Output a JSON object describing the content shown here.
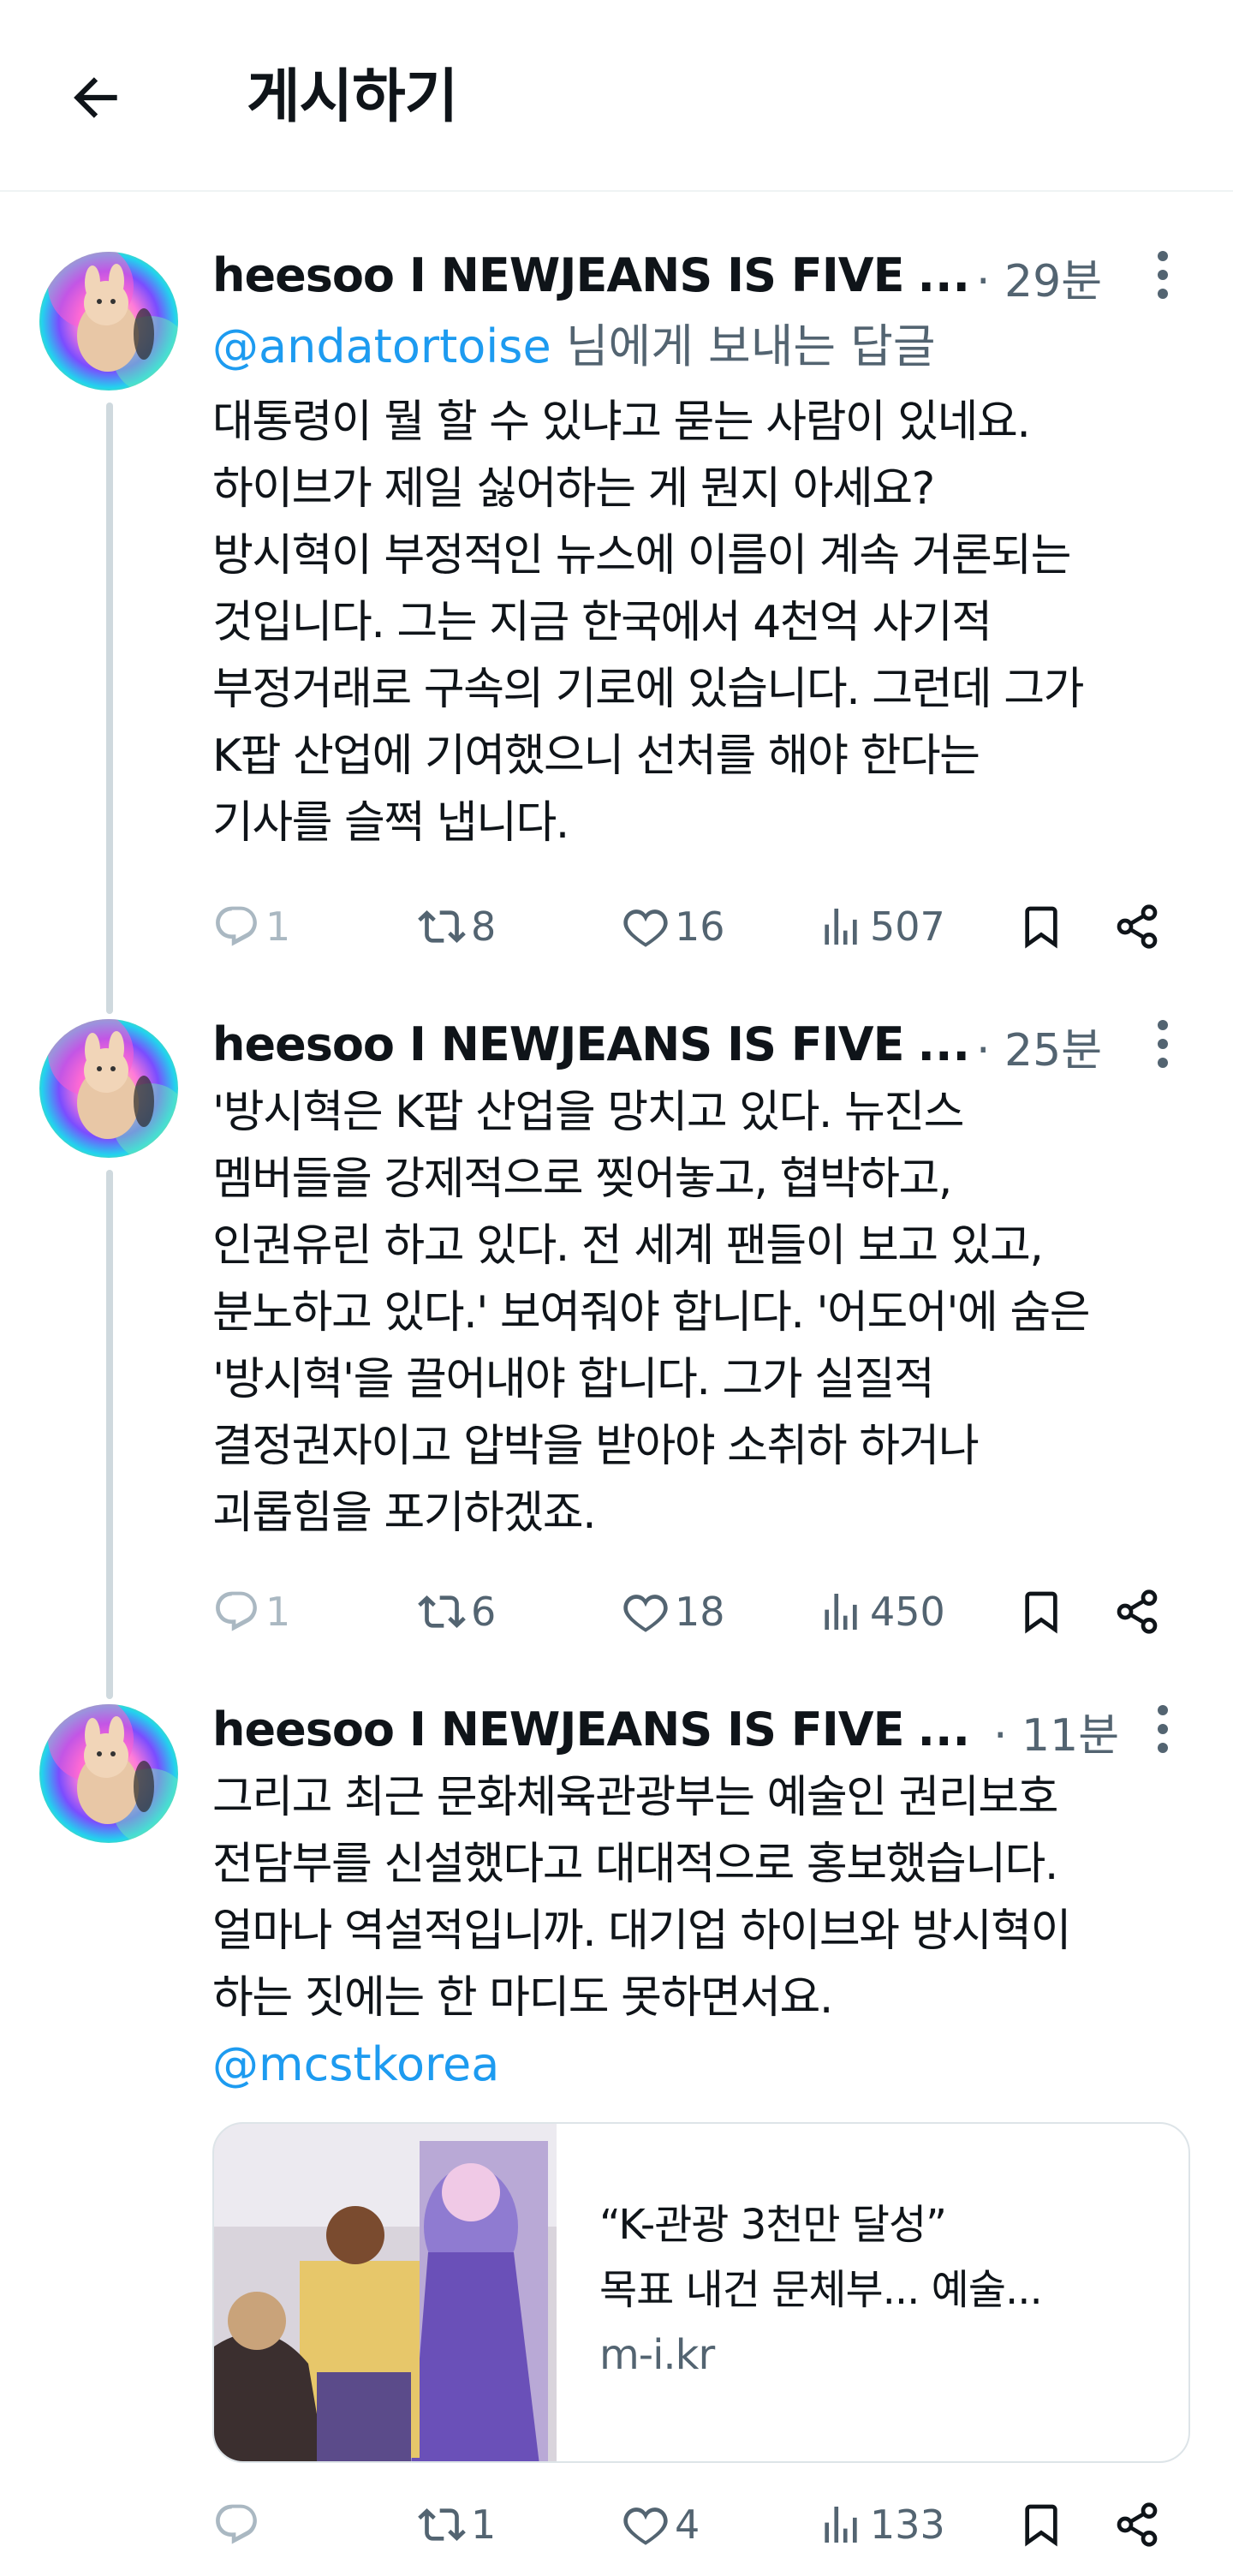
{
  "header": {
    "title": "게시하기",
    "back_icon": "arrow-left-icon"
  },
  "colors": {
    "accent": "#1d9bf0",
    "muted": "#536471",
    "text": "#0f1419",
    "border": "#eff3f4"
  },
  "posts": [
    {
      "display_name": "heesoo I NEWJEANS IS FIVE",
      "ellipsis": "...",
      "time": "· 29분",
      "reply_to": {
        "handle": "@andatortoise",
        "suffix": " 님에게 보내는 답글"
      },
      "lines": [
        "대통령이 뭘 할 수 있냐고 묻는 사람이 있네요.",
        "하이브가 제일 싫어하는 게 뭔지 아세요?",
        "방시혁이 부정적인 뉴스에 이름이 계속 거론되는",
        "것입니다. 그는 지금 한국에서 4천억 사기적",
        "부정거래로 구속의 기로에 있습니다. 그런데 그가",
        "K팝 산업에 기여했으니 선처를 해야 한다는",
        "기사를 슬쩍 냅니다."
      ],
      "stats": {
        "replies": "1",
        "reposts": "8",
        "likes": "16",
        "views": "507"
      }
    },
    {
      "display_name": "heesoo I NEWJEANS IS FIVE",
      "ellipsis": "...",
      "time": "· 25분",
      "lines": [
        "'방시혁은 K팝 산업을 망치고 있다. 뉴진스",
        "멤버들을 강제적으로 찢어놓고, 협박하고,",
        "인권유린 하고 있다. 전 세계 팬들이 보고 있고,",
        "분노하고 있다.' 보여줘야 합니다. '어도어'에 숨은",
        "'방시혁'을 끌어내야 합니다. 그가 실질적",
        "결정권자이고 압박을 받아야 소취하 하거나",
        "괴롭힘을 포기하겠죠."
      ],
      "stats": {
        "replies": "1",
        "reposts": "6",
        "likes": "18",
        "views": "450"
      }
    },
    {
      "display_name": "heesoo I NEWJEANS IS FIVE",
      "ellipsis": "...",
      "time": "· 11분",
      "lines": [
        "그리고 최근 문화체육관광부는 예술인 권리보호",
        "전담부를 신설했다고 대대적으로 홍보했습니다.",
        "얼마나 역설적입니까. 대기업 하이브와 방시혁이",
        "하는 짓에는 한 마디도 못하면서요."
      ],
      "mention": "@mcstkorea",
      "card": {
        "title": "“K-관광 3천만 달성”",
        "description": "목표 내건 문체부... 예술...",
        "domain": "m-i.kr"
      },
      "stats": {
        "replies": "",
        "reposts": "1",
        "likes": "4",
        "views": "133"
      }
    }
  ]
}
